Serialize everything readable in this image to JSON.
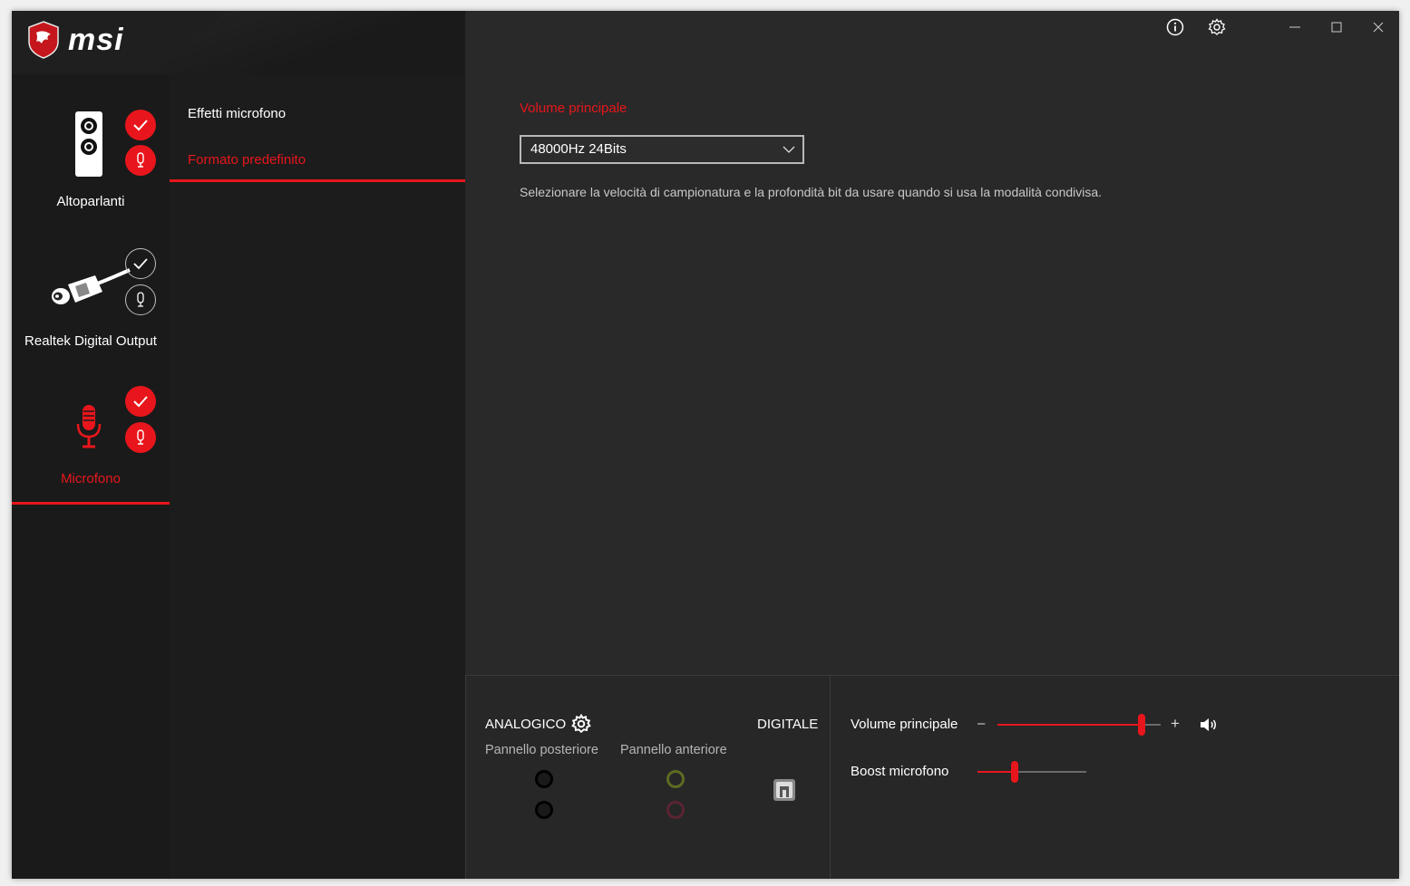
{
  "brand": {
    "logo_text": "msi",
    "accent_color": "#e8161c"
  },
  "devices": [
    {
      "label": "Altoparlanti",
      "icon": "speaker-icon",
      "default_state": "checked",
      "comm_state": "mic-default",
      "active": false
    },
    {
      "label": "Realtek Digital Output",
      "icon": "digital-cable-icon",
      "default_state": "outline-check",
      "comm_state": "outline-mic",
      "active": false
    },
    {
      "label": "Microfono",
      "icon": "microphone-icon",
      "default_state": "checked",
      "comm_state": "mic-default",
      "active": true
    }
  ],
  "submenu": {
    "items": [
      {
        "label": "Effetti microfono",
        "active": false
      },
      {
        "label": "Formato predefinito",
        "active": true
      }
    ]
  },
  "titlebar": {
    "info_icon": "info-icon",
    "settings_icon": "gear-icon",
    "minimize_icon": "minimize-icon",
    "maximize_icon": "maximize-icon",
    "close_icon": "close-icon"
  },
  "main": {
    "section_title": "Volume principale",
    "format_select": {
      "value": "48000Hz 24Bits"
    },
    "description": "Selezionare la velocità di campionatura e la profondità bit da usare quando si usa la modalità condivisa."
  },
  "bottom": {
    "analog_label": "ANALOGICO",
    "digital_label": "DIGITALE",
    "rear_panel_label": "Pannello posteriore",
    "front_panel_label": "Pannello anteriore",
    "jacks": {
      "rear": [
        "#000000",
        "#000000"
      ],
      "front": [
        "#6a7a2a",
        "#6a2a3a"
      ]
    },
    "master_volume_label": "Volume principale",
    "master_volume_value": 0.88,
    "minus_symbol": "–",
    "plus_symbol": "+",
    "mic_boost_label": "Boost microfono",
    "mic_boost_value": 0.33
  }
}
